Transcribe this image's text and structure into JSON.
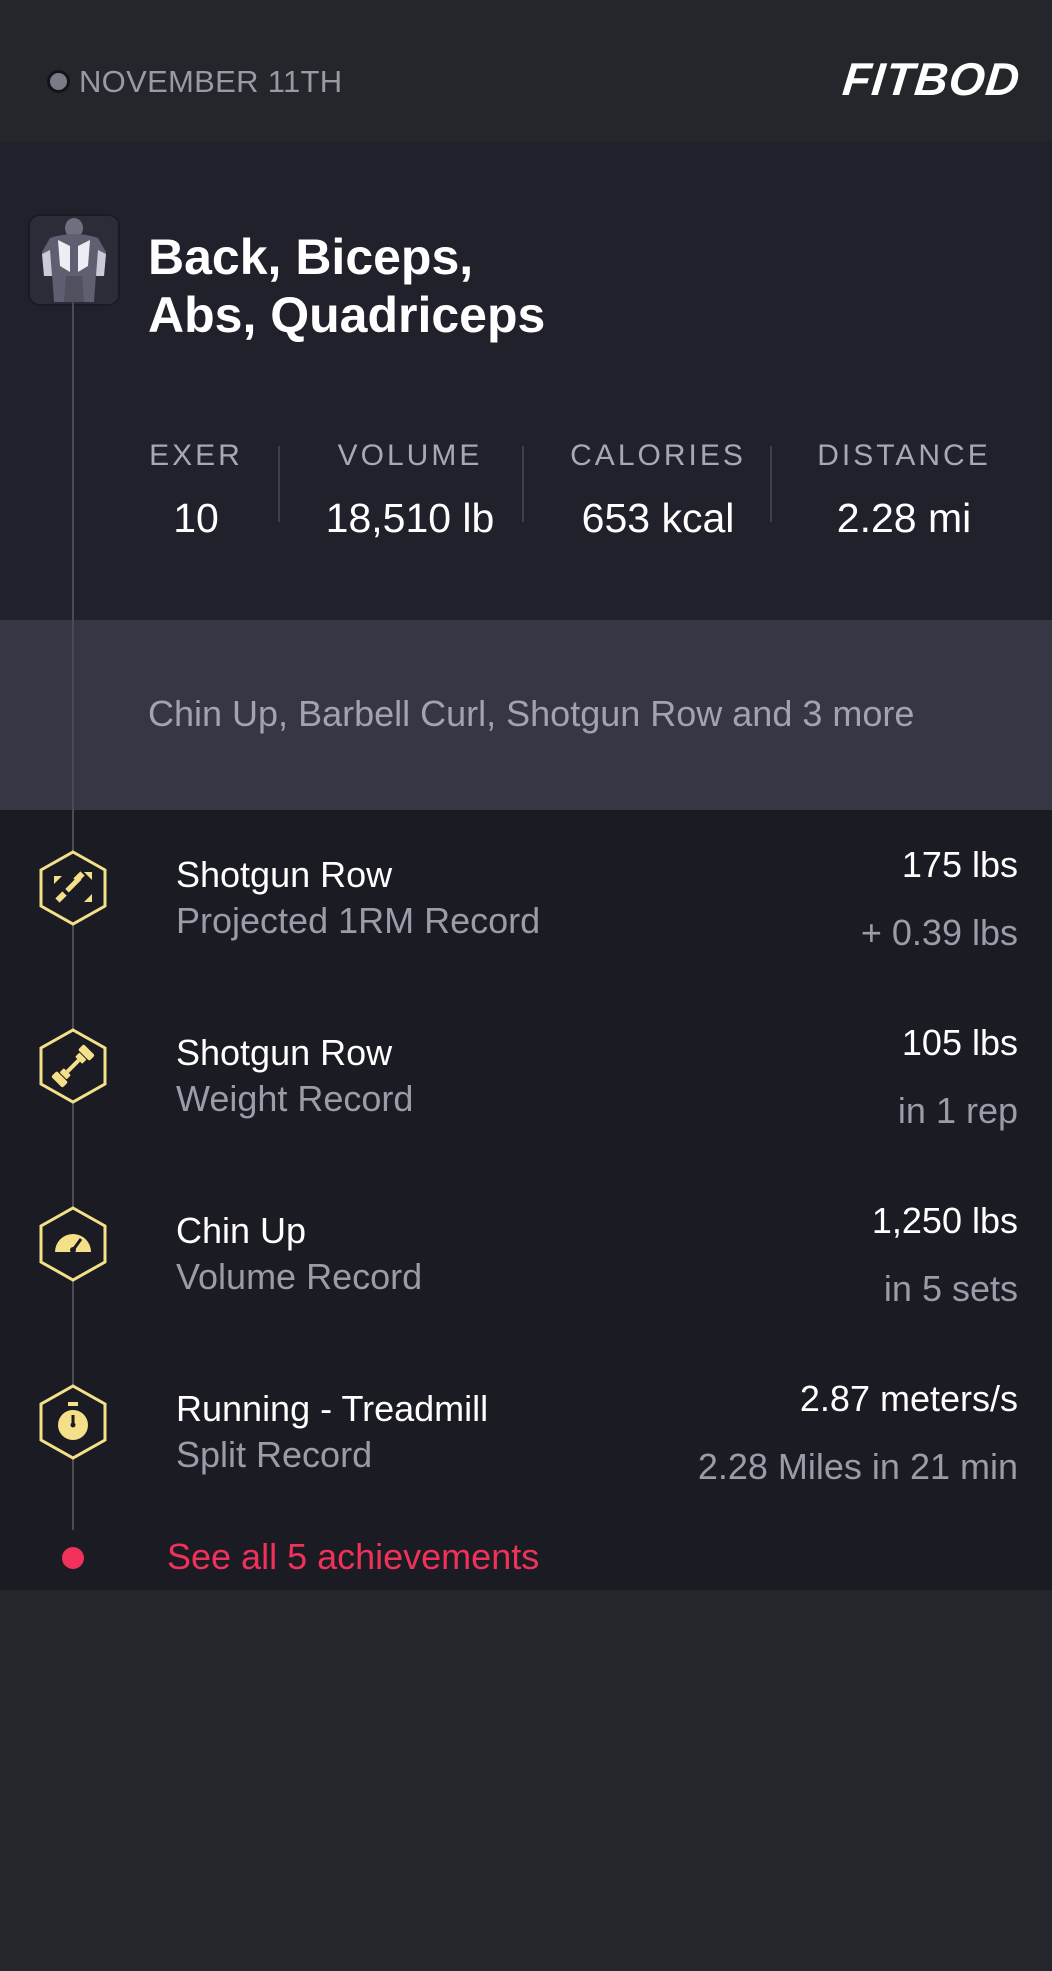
{
  "header": {
    "date": "NOVEMBER 11TH",
    "logo": "FITBOD"
  },
  "workout": {
    "title_line1": "Back, Biceps,",
    "title_line2": "Abs, Quadriceps",
    "muscle_icon": "muscle-figure-icon",
    "stats": [
      {
        "label": "EXER",
        "value": "10"
      },
      {
        "label": "VOLUME",
        "value": "18,510 lb"
      },
      {
        "label": "CALORIES",
        "value": "653 kcal"
      },
      {
        "label": "DISTANCE",
        "value": "2.28 mi"
      }
    ],
    "exercises_summary": "Chin Up, Barbell Curl, Shotgun Row and 3 more"
  },
  "achievements": [
    {
      "name": "Shotgun Row",
      "type": "Projected 1RM Record",
      "value": "175 lbs",
      "detail": "+ 0.39 lbs",
      "icon": "projected-1rm-icon"
    },
    {
      "name": "Shotgun Row",
      "type": "Weight Record",
      "value": "105 lbs",
      "detail": "in 1 rep",
      "icon": "dumbbell-icon"
    },
    {
      "name": "Chin Up",
      "type": "Volume Record",
      "value": "1,250 lbs",
      "detail": "in 5 sets",
      "icon": "gauge-icon"
    },
    {
      "name": "Running - Treadmill",
      "type": "Split Record",
      "value": "2.87 meters/s",
      "detail": "2.28 Miles in 21 min",
      "icon": "stopwatch-icon"
    }
  ],
  "see_all": "See all 5 achievements",
  "colors": {
    "accent_red": "#f0325a",
    "badge_yellow": "#f5e08a",
    "background": "#23272b"
  }
}
